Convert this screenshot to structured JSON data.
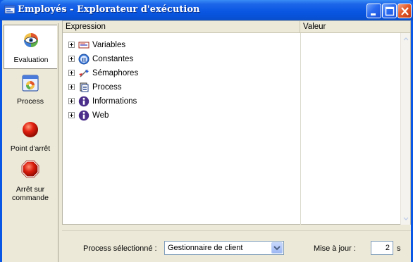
{
  "window": {
    "title": "Employés - Explorateur d'exécution"
  },
  "sidebar": {
    "items": [
      {
        "label": "Evaluation",
        "icon": "eye-colorwheel-icon",
        "selected": true
      },
      {
        "label": "Process",
        "icon": "process-window-icon",
        "selected": false
      },
      {
        "label": "Point d'arrêt",
        "icon": "red-ball-icon",
        "selected": false
      },
      {
        "label": "Arrêt sur commande",
        "icon": "stop-sign-icon",
        "selected": false
      }
    ]
  },
  "grid": {
    "columns": [
      "Expression",
      "Valeur"
    ],
    "rows": [
      {
        "label": "Variables",
        "icon": "variables-icon"
      },
      {
        "label": "Constantes",
        "icon": "pi-icon"
      },
      {
        "label": "Sémaphores",
        "icon": "semaphore-icon"
      },
      {
        "label": "Process",
        "icon": "process-icon"
      },
      {
        "label": "Informations",
        "icon": "info-icon"
      },
      {
        "label": "Web",
        "icon": "info-icon"
      }
    ]
  },
  "bottom": {
    "process_label": "Process sélectionné :",
    "process_value": "Gestionnaire de client",
    "update_label": "Mise à jour :",
    "update_value": "2",
    "update_unit": "s"
  },
  "colors": {
    "titlebar": "#0A57E3",
    "panel": "#ECE9D8",
    "close_button": "#E35A2A"
  }
}
